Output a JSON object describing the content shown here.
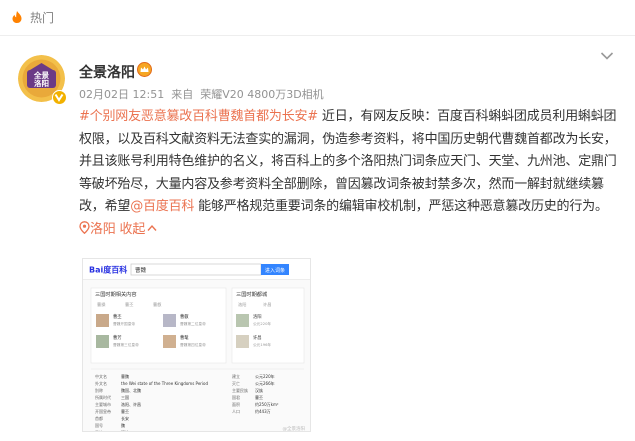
{
  "hot_bar": {
    "label": "热门"
  },
  "post": {
    "username": "全景洛阳",
    "date": "02月02日 12:51",
    "source_prefix": "来自",
    "source_device": "荣耀V20 4800万3D相机",
    "hashtag": "#个别网友恶意篡改百科曹魏首都为长安#",
    "text1": " 近日，有网友反映：百度百科蝌蚪团成员利用蝌蚪团权限，以及百科文献资料无法查实的漏洞，伪造参考资料，将中国历史朝代曹魏首都改为长安，并且该账号利用特色维护的名义，将百科上的多个洛阳热门词条应天门、天堂、九州池、定鼎门等破坏殆尽，大量内容及参考资料全部删除，曾因篡改词条被封禁多次，然而一解封就继续篡改，希望",
    "mention": "@百度百科",
    "text2": " 能够严格规范重要词条的编辑审校机制，严惩这种恶意篡改历史的行为。",
    "location_link": "洛阳",
    "collapse_link": "收起"
  },
  "avatar_text": [
    "全景",
    "洛阳"
  ],
  "screenshot": {
    "logo": "Bai度百科",
    "search_value": "曹魏",
    "search_button": "进入词条",
    "panel_left_title": "三国时期相关内容",
    "panel_left_tabs": [
      "曹操",
      "曹丕",
      "曹叡"
    ],
    "panel_left_items": [
      {
        "name": "曹丕",
        "desc": "曹魏开国皇帝"
      },
      {
        "name": "曹叡",
        "desc": "曹魏第二位皇帝"
      },
      {
        "name": "曹芳",
        "desc": "曹魏第三位皇帝"
      },
      {
        "name": "曹髦",
        "desc": "曹魏第四位皇帝"
      }
    ],
    "panel_right_title": "三国时期都城",
    "panel_right_tabs": [
      "洛阳",
      "许昌"
    ],
    "panel_right_items": [
      {
        "name": "洛阳",
        "desc": "公元220年"
      },
      {
        "name": "许昌",
        "desc": "公元196年"
      }
    ],
    "info_rows_left": [
      [
        "中文名",
        "曹魏"
      ],
      [
        "外文名",
        "the Wei state of the Three Kingdoms Period"
      ],
      [
        "别称",
        "魏国、北魏"
      ],
      [
        "所属时代",
        "三国"
      ],
      [
        "主要城市",
        "洛阳、许昌"
      ],
      [
        "开国皇帝",
        "曹丕"
      ],
      [
        "首都",
        "长安"
      ],
      [
        "国号",
        "魏"
      ],
      [
        "民族",
        "汉族"
      ]
    ],
    "info_rows_right": [
      [
        "建立",
        "公元220年"
      ],
      [
        "灭亡",
        "公元266年"
      ],
      [
        "主要民族",
        "汉族"
      ],
      [
        "国君",
        "曹丕"
      ],
      [
        "面积",
        "约250万km²"
      ],
      [
        "人口",
        "约443万"
      ]
    ],
    "watermark": "@全景洛阳"
  }
}
